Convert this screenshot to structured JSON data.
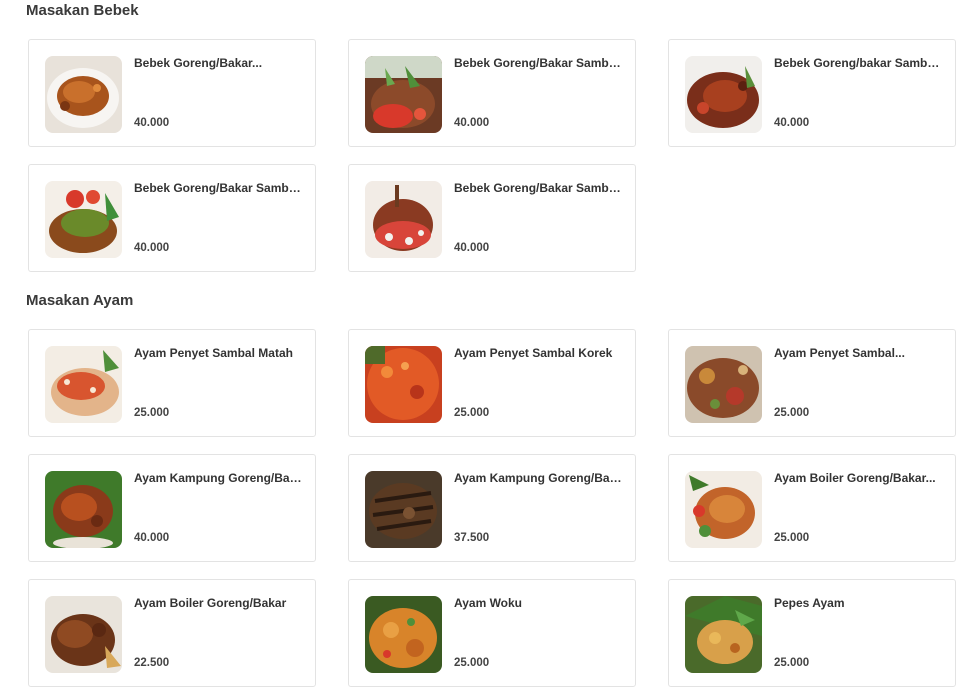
{
  "sections": [
    {
      "title": "Masakan Bebek",
      "items": [
        {
          "name": "Bebek Goreng/Bakar...",
          "price": "40.000",
          "image": "fried-duck-plate"
        },
        {
          "name": "Bebek Goreng/Bakar Sambal...",
          "price": "40.000",
          "image": "duck-sambal-matah"
        },
        {
          "name": "Bebek Goreng/bakar Sambal...",
          "price": "40.000",
          "image": "duck-sambal-korek"
        },
        {
          "name": "Bebek Goreng/Bakar Sambal...",
          "price": "40.000",
          "image": "duck-sambal-ijo"
        },
        {
          "name": "Bebek Goreng/Bakar Sambal...",
          "price": "40.000",
          "image": "duck-sambal-bawang"
        }
      ]
    },
    {
      "title": "Masakan Ayam",
      "items": [
        {
          "name": "Ayam Penyet Sambal Matah",
          "price": "25.000",
          "image": "chicken-sambal-matah"
        },
        {
          "name": "Ayam Penyet Sambal Korek",
          "price": "25.000",
          "image": "chicken-sambal-korek"
        },
        {
          "name": "Ayam Penyet Sambal...",
          "price": "25.000",
          "image": "chicken-sambal-mixed"
        },
        {
          "name": "Ayam Kampung Goreng/Bak...",
          "price": "40.000",
          "image": "village-chicken-fried"
        },
        {
          "name": "Ayam Kampung Goreng/Bakar",
          "price": "37.500",
          "image": "village-chicken-grilled"
        },
        {
          "name": "Ayam Boiler Goreng/Bakar...",
          "price": "25.000",
          "image": "broiler-chicken-sambal"
        },
        {
          "name": "Ayam Boiler Goreng/Bakar",
          "price": "22.500",
          "image": "broiler-chicken-grilled"
        },
        {
          "name": "Ayam Woku",
          "price": "25.000",
          "image": "chicken-woku"
        },
        {
          "name": "Pepes Ayam",
          "price": "25.000",
          "image": "chicken-pepes"
        }
      ]
    }
  ]
}
